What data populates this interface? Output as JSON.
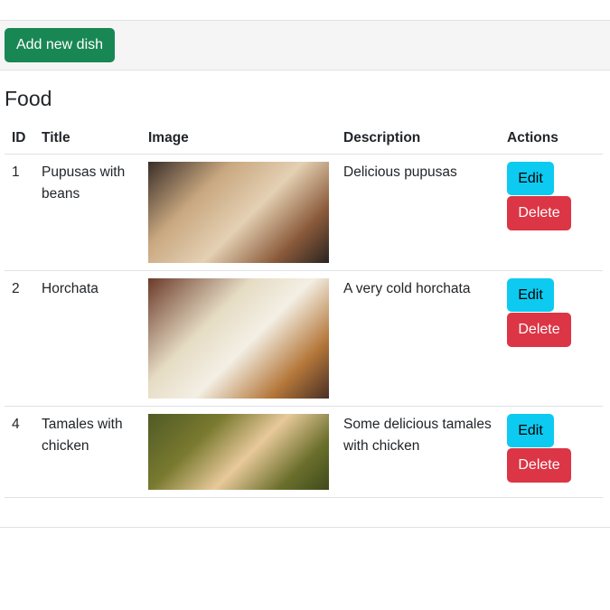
{
  "toolbar": {
    "add_label": "Add new dish"
  },
  "page": {
    "title": "Food"
  },
  "table": {
    "headers": {
      "id": "ID",
      "title": "Title",
      "image": "Image",
      "description": "Description",
      "actions": "Actions"
    },
    "rows": [
      {
        "id": "1",
        "title": "Pupusas with beans",
        "image_alt": "Pupusas",
        "description": "Delicious pupusas",
        "edit_label": "Edit",
        "delete_label": "Delete"
      },
      {
        "id": "2",
        "title": "Horchata",
        "image_alt": "Horchata",
        "description": "A very cold horchata",
        "edit_label": "Edit",
        "delete_label": "Delete"
      },
      {
        "id": "4",
        "title": "Tamales with chicken",
        "image_alt": "Tamales",
        "description": "Some delicious tamales with chicken",
        "edit_label": "Edit",
        "delete_label": "Delete"
      }
    ]
  },
  "colors": {
    "add_button": "#198754",
    "edit_button": "#0dcaf0",
    "delete_button": "#dc3545",
    "toolbar_bg": "#f5f5f5"
  }
}
